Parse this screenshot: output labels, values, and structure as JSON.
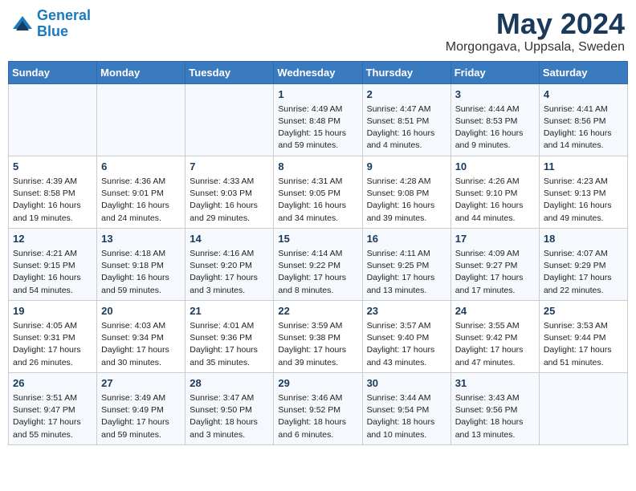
{
  "header": {
    "logo_line1": "General",
    "logo_line2": "Blue",
    "month": "May 2024",
    "location": "Morgongava, Uppsala, Sweden"
  },
  "weekdays": [
    "Sunday",
    "Monday",
    "Tuesday",
    "Wednesday",
    "Thursday",
    "Friday",
    "Saturday"
  ],
  "weeks": [
    [
      {
        "day": "",
        "info": ""
      },
      {
        "day": "",
        "info": ""
      },
      {
        "day": "",
        "info": ""
      },
      {
        "day": "1",
        "info": "Sunrise: 4:49 AM\nSunset: 8:48 PM\nDaylight: 15 hours\nand 59 minutes."
      },
      {
        "day": "2",
        "info": "Sunrise: 4:47 AM\nSunset: 8:51 PM\nDaylight: 16 hours\nand 4 minutes."
      },
      {
        "day": "3",
        "info": "Sunrise: 4:44 AM\nSunset: 8:53 PM\nDaylight: 16 hours\nand 9 minutes."
      },
      {
        "day": "4",
        "info": "Sunrise: 4:41 AM\nSunset: 8:56 PM\nDaylight: 16 hours\nand 14 minutes."
      }
    ],
    [
      {
        "day": "5",
        "info": "Sunrise: 4:39 AM\nSunset: 8:58 PM\nDaylight: 16 hours\nand 19 minutes."
      },
      {
        "day": "6",
        "info": "Sunrise: 4:36 AM\nSunset: 9:01 PM\nDaylight: 16 hours\nand 24 minutes."
      },
      {
        "day": "7",
        "info": "Sunrise: 4:33 AM\nSunset: 9:03 PM\nDaylight: 16 hours\nand 29 minutes."
      },
      {
        "day": "8",
        "info": "Sunrise: 4:31 AM\nSunset: 9:05 PM\nDaylight: 16 hours\nand 34 minutes."
      },
      {
        "day": "9",
        "info": "Sunrise: 4:28 AM\nSunset: 9:08 PM\nDaylight: 16 hours\nand 39 minutes."
      },
      {
        "day": "10",
        "info": "Sunrise: 4:26 AM\nSunset: 9:10 PM\nDaylight: 16 hours\nand 44 minutes."
      },
      {
        "day": "11",
        "info": "Sunrise: 4:23 AM\nSunset: 9:13 PM\nDaylight: 16 hours\nand 49 minutes."
      }
    ],
    [
      {
        "day": "12",
        "info": "Sunrise: 4:21 AM\nSunset: 9:15 PM\nDaylight: 16 hours\nand 54 minutes."
      },
      {
        "day": "13",
        "info": "Sunrise: 4:18 AM\nSunset: 9:18 PM\nDaylight: 16 hours\nand 59 minutes."
      },
      {
        "day": "14",
        "info": "Sunrise: 4:16 AM\nSunset: 9:20 PM\nDaylight: 17 hours\nand 3 minutes."
      },
      {
        "day": "15",
        "info": "Sunrise: 4:14 AM\nSunset: 9:22 PM\nDaylight: 17 hours\nand 8 minutes."
      },
      {
        "day": "16",
        "info": "Sunrise: 4:11 AM\nSunset: 9:25 PM\nDaylight: 17 hours\nand 13 minutes."
      },
      {
        "day": "17",
        "info": "Sunrise: 4:09 AM\nSunset: 9:27 PM\nDaylight: 17 hours\nand 17 minutes."
      },
      {
        "day": "18",
        "info": "Sunrise: 4:07 AM\nSunset: 9:29 PM\nDaylight: 17 hours\nand 22 minutes."
      }
    ],
    [
      {
        "day": "19",
        "info": "Sunrise: 4:05 AM\nSunset: 9:31 PM\nDaylight: 17 hours\nand 26 minutes."
      },
      {
        "day": "20",
        "info": "Sunrise: 4:03 AM\nSunset: 9:34 PM\nDaylight: 17 hours\nand 30 minutes."
      },
      {
        "day": "21",
        "info": "Sunrise: 4:01 AM\nSunset: 9:36 PM\nDaylight: 17 hours\nand 35 minutes."
      },
      {
        "day": "22",
        "info": "Sunrise: 3:59 AM\nSunset: 9:38 PM\nDaylight: 17 hours\nand 39 minutes."
      },
      {
        "day": "23",
        "info": "Sunrise: 3:57 AM\nSunset: 9:40 PM\nDaylight: 17 hours\nand 43 minutes."
      },
      {
        "day": "24",
        "info": "Sunrise: 3:55 AM\nSunset: 9:42 PM\nDaylight: 17 hours\nand 47 minutes."
      },
      {
        "day": "25",
        "info": "Sunrise: 3:53 AM\nSunset: 9:44 PM\nDaylight: 17 hours\nand 51 minutes."
      }
    ],
    [
      {
        "day": "26",
        "info": "Sunrise: 3:51 AM\nSunset: 9:47 PM\nDaylight: 17 hours\nand 55 minutes."
      },
      {
        "day": "27",
        "info": "Sunrise: 3:49 AM\nSunset: 9:49 PM\nDaylight: 17 hours\nand 59 minutes."
      },
      {
        "day": "28",
        "info": "Sunrise: 3:47 AM\nSunset: 9:50 PM\nDaylight: 18 hours\nand 3 minutes."
      },
      {
        "day": "29",
        "info": "Sunrise: 3:46 AM\nSunset: 9:52 PM\nDaylight: 18 hours\nand 6 minutes."
      },
      {
        "day": "30",
        "info": "Sunrise: 3:44 AM\nSunset: 9:54 PM\nDaylight: 18 hours\nand 10 minutes."
      },
      {
        "day": "31",
        "info": "Sunrise: 3:43 AM\nSunset: 9:56 PM\nDaylight: 18 hours\nand 13 minutes."
      },
      {
        "day": "",
        "info": ""
      }
    ]
  ]
}
